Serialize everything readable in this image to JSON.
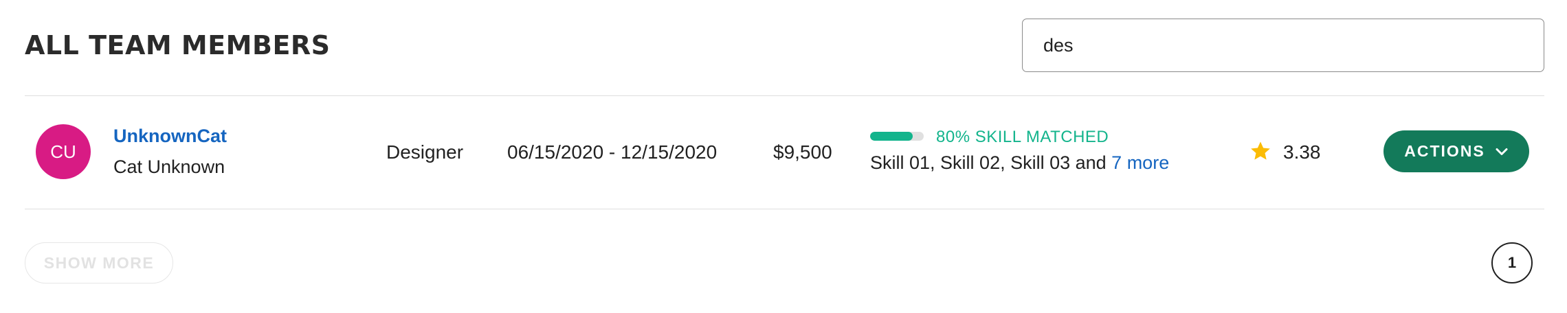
{
  "header": {
    "title": "ALL TEAM MEMBERS"
  },
  "search": {
    "value": "des",
    "placeholder": ""
  },
  "members": [
    {
      "avatar_initials": "CU",
      "avatar_color": "#d81b84",
      "username": "UnknownCat",
      "full_name": "Cat Unknown",
      "role": "Designer",
      "dates": "06/15/2020 - 12/15/2020",
      "rate": "$9,500",
      "skill_match": {
        "percent": 80,
        "label": "80% SKILL MATCHED",
        "color": "#13b48c"
      },
      "skills_text": "Skill 01, Skill 02, Skill 03 and ",
      "skills_more": "7 more",
      "rating": "3.38",
      "rating_icon": "star-icon",
      "actions_label": "ACTIONS",
      "actions_icon": "chevron-down-icon"
    }
  ],
  "footer": {
    "show_more_label": "SHOW MORE",
    "current_page": "1"
  },
  "colors": {
    "link": "#1565c0",
    "accent": "#137a5a",
    "star": "#fbbc05"
  }
}
